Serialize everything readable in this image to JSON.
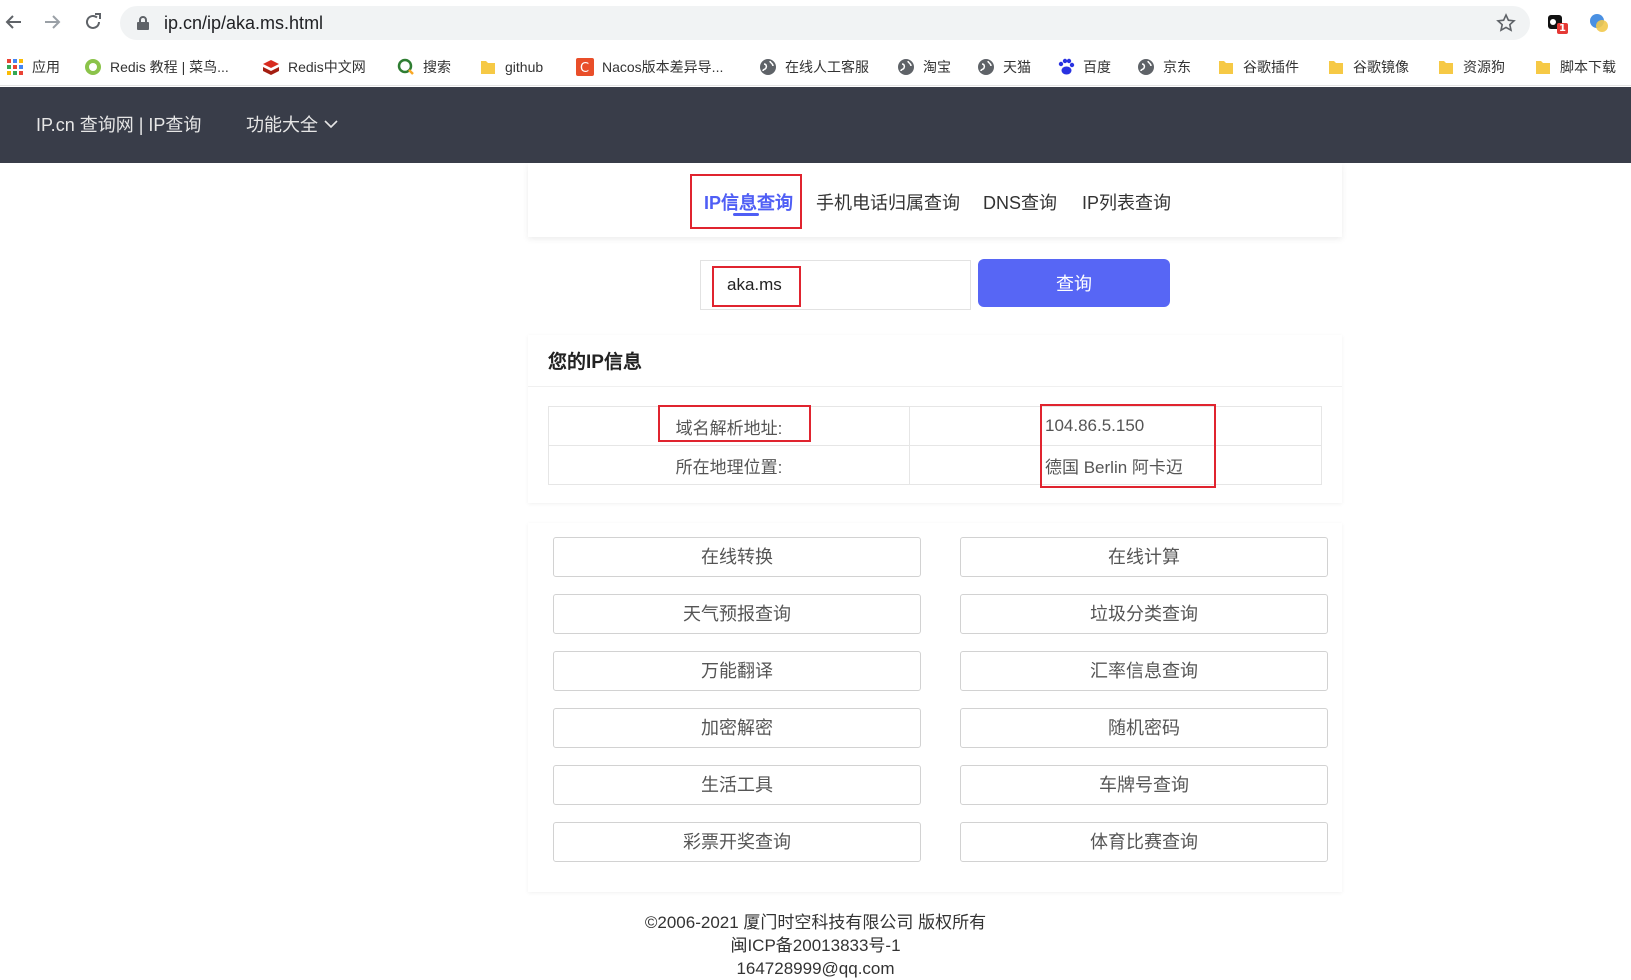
{
  "browser": {
    "url": "ip.cn/ip/aka.ms.html",
    "extension_badge": "1",
    "bookmarks": [
      {
        "label": "应用",
        "icon": "apps-grid-icon"
      },
      {
        "label": "Redis 教程 | 菜鸟...",
        "icon": "runoob-icon"
      },
      {
        "label": "Redis中文网",
        "icon": "redis-icon"
      },
      {
        "label": "搜索",
        "icon": "search-q-icon"
      },
      {
        "label": "github",
        "icon": "folder-icon"
      },
      {
        "label": "Nacos版本差异导...",
        "icon": "csdn-icon"
      },
      {
        "label": "在线人工客服",
        "icon": "globe-icon"
      },
      {
        "label": "淘宝",
        "icon": "globe-icon"
      },
      {
        "label": "天猫",
        "icon": "globe-icon"
      },
      {
        "label": "百度",
        "icon": "baidu-paw-icon"
      },
      {
        "label": "京东",
        "icon": "globe-icon"
      },
      {
        "label": "谷歌插件",
        "icon": "folder-icon"
      },
      {
        "label": "谷歌镜像",
        "icon": "folder-icon"
      },
      {
        "label": "资源狗",
        "icon": "folder-icon"
      },
      {
        "label": "脚本下载",
        "icon": "folder-icon"
      }
    ]
  },
  "header": {
    "brand": "IP.cn 查询网 | IP查询",
    "menu": "功能大全"
  },
  "tabs": [
    "IP信息查询",
    "手机电话归属查询",
    "DNS查询",
    "IP列表查询"
  ],
  "search": {
    "value": "aka.ms",
    "button": "查询"
  },
  "info": {
    "title": "您的IP信息",
    "rows": [
      {
        "key": "域名解析地址:",
        "value": "104.86.5.150"
      },
      {
        "key": "所在地理位置:",
        "value": "德国 Berlin 阿卡迈"
      }
    ]
  },
  "tools": [
    "在线转换",
    "在线计算",
    "天气预报查询",
    "垃圾分类查询",
    "万能翻译",
    "汇率信息查询",
    "加密解密",
    "随机密码",
    "生活工具",
    "车牌号查询",
    "彩票开奖查询",
    "体育比赛查询"
  ],
  "footer": {
    "line1": "©2006-2021 厦门时空科技有限公司 版权所有",
    "line2": "闽ICP备20013833号-1",
    "line3": "164728999@qq.com"
  },
  "colors": {
    "accent": "#5766f5",
    "header_bg": "#393d49",
    "annotation": "#e0242f"
  }
}
